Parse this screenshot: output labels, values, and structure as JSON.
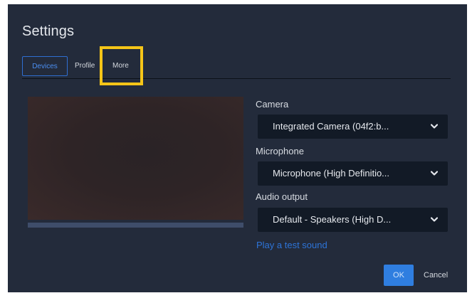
{
  "dialog": {
    "title": "Settings"
  },
  "tabs": [
    {
      "label": "Devices",
      "active": true
    },
    {
      "label": "Profile",
      "active": false
    },
    {
      "label": "More",
      "active": false
    }
  ],
  "camera": {
    "label": "Camera",
    "value": "Integrated Camera (04f2:b..."
  },
  "microphone": {
    "label": "Microphone",
    "value": "Microphone (High Definitio..."
  },
  "audio_output": {
    "label": "Audio output",
    "value": "Default - Speakers (High D..."
  },
  "test_sound": {
    "label": "Play a test sound"
  },
  "buttons": {
    "ok": "OK",
    "cancel": "Cancel"
  },
  "icons": {
    "select_chevron": "chevron-down-icon"
  },
  "colors": {
    "dialog_bg": "#232b3b",
    "accent": "#2f7ee0",
    "link": "#2d74d8",
    "highlight": "#f5c518",
    "select_bg": "#121a26"
  }
}
